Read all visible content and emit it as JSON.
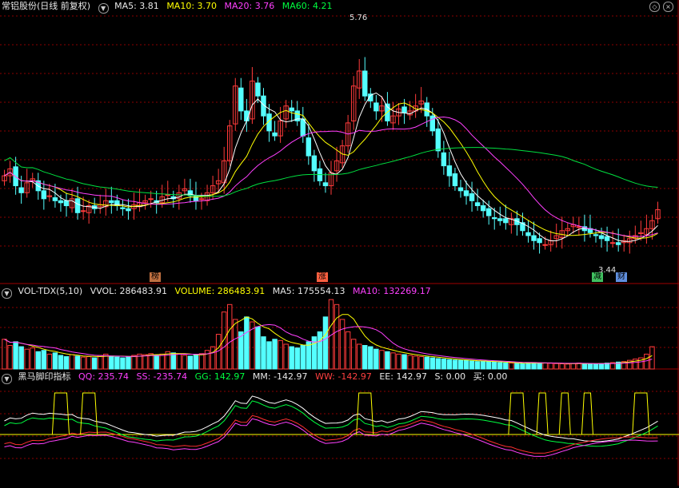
{
  "colors": {
    "up": "#ff3b3b",
    "down": "#54ffff",
    "ma5": "#ffffff",
    "ma10": "#ffff00",
    "ma20": "#ff40ff",
    "ma60": "#00e040",
    "grid": "#8b0000"
  },
  "main": {
    "title": "常铝股份(日线 前复权)",
    "ma5": "MA5: 3.81",
    "ma10": "MA10: 3.70",
    "ma20": "MA20: 3.76",
    "ma60": "MA60: 4.21",
    "high_label": "5.76",
    "low_label": "3.44",
    "markers": [
      {
        "text": "榜"
      },
      {
        "text": "涨"
      },
      {
        "text": "减"
      },
      {
        "text": "财"
      }
    ]
  },
  "vol": {
    "title": "VOL-TDX(5,10)",
    "vvol": "VVOL: 286483.91",
    "volume": "VOLUME: 286483.91",
    "ma5": "MA5: 175554.13",
    "ma10": "MA10: 132269.17"
  },
  "ind": {
    "title": "黑马脚印指标",
    "qq": "QQ: 235.74",
    "ss": "SS: -235.74",
    "gg": "GG: 142.97",
    "mm": "MM: -142.97",
    "ww": "WW: -142.97",
    "ee": "EE: 142.97",
    "s": "S: 0.00",
    "buy": "买: 0.00"
  },
  "chart_data": {
    "type": "candlestick",
    "series_high": 5.76,
    "series_low": 3.44,
    "close": [
      4.15,
      4.22,
      4.05,
      3.98,
      4.08,
      4.12,
      4.0,
      3.92,
      3.95,
      3.9,
      3.88,
      3.85,
      3.92,
      3.78,
      3.8,
      3.85,
      3.82,
      3.86,
      3.9,
      3.88,
      3.85,
      3.82,
      3.8,
      3.86,
      3.88,
      3.9,
      3.92,
      3.88,
      3.94,
      3.96,
      3.92,
      3.98,
      4.02,
      3.95,
      3.9,
      3.92,
      3.98,
      4.05,
      4.1,
      4.3,
      4.65,
      5.05,
      4.8,
      4.7,
      5.1,
      4.95,
      4.75,
      4.6,
      4.55,
      4.7,
      4.85,
      4.8,
      4.7,
      4.55,
      4.35,
      4.2,
      4.1,
      4.05,
      4.18,
      4.3,
      4.45,
      4.68,
      5.05,
      5.2,
      4.95,
      4.9,
      4.8,
      4.85,
      4.7,
      4.75,
      4.82,
      4.78,
      4.8,
      4.85,
      4.9,
      4.75,
      4.6,
      4.4,
      4.25,
      4.15,
      4.05,
      4.0,
      3.95,
      3.9,
      3.85,
      3.8,
      3.75,
      3.72,
      3.7,
      3.68,
      3.72,
      3.66,
      3.6,
      3.55,
      3.5,
      3.48,
      3.46,
      3.5,
      3.55,
      3.6,
      3.62,
      3.66,
      3.64,
      3.6,
      3.58,
      3.55,
      3.52,
      3.5,
      3.48,
      3.46,
      3.5,
      3.52,
      3.55,
      3.58,
      3.62,
      3.7,
      3.81
    ],
    "volume": [
      120,
      95,
      110,
      90,
      80,
      85,
      70,
      75,
      60,
      65,
      55,
      50,
      58,
      52,
      48,
      50,
      45,
      55,
      60,
      52,
      48,
      45,
      50,
      55,
      60,
      58,
      62,
      55,
      60,
      70,
      65,
      60,
      55,
      52,
      58,
      62,
      75,
      90,
      140,
      230,
      260,
      200,
      150,
      210,
      190,
      170,
      130,
      110,
      120,
      115,
      100,
      90,
      85,
      95,
      110,
      130,
      150,
      210,
      280,
      260,
      200,
      150,
      120,
      100,
      95,
      90,
      80,
      75,
      70,
      65,
      60,
      58,
      55,
      52,
      50,
      48,
      45,
      42,
      40,
      38,
      36,
      35,
      34,
      32,
      30,
      32,
      30,
      28,
      26,
      25,
      24,
      23,
      22,
      24,
      26,
      25,
      24,
      23,
      22,
      21,
      20,
      22,
      24,
      22,
      21,
      20,
      22,
      24,
      26,
      28,
      30,
      35,
      40,
      45,
      60,
      90
    ]
  }
}
